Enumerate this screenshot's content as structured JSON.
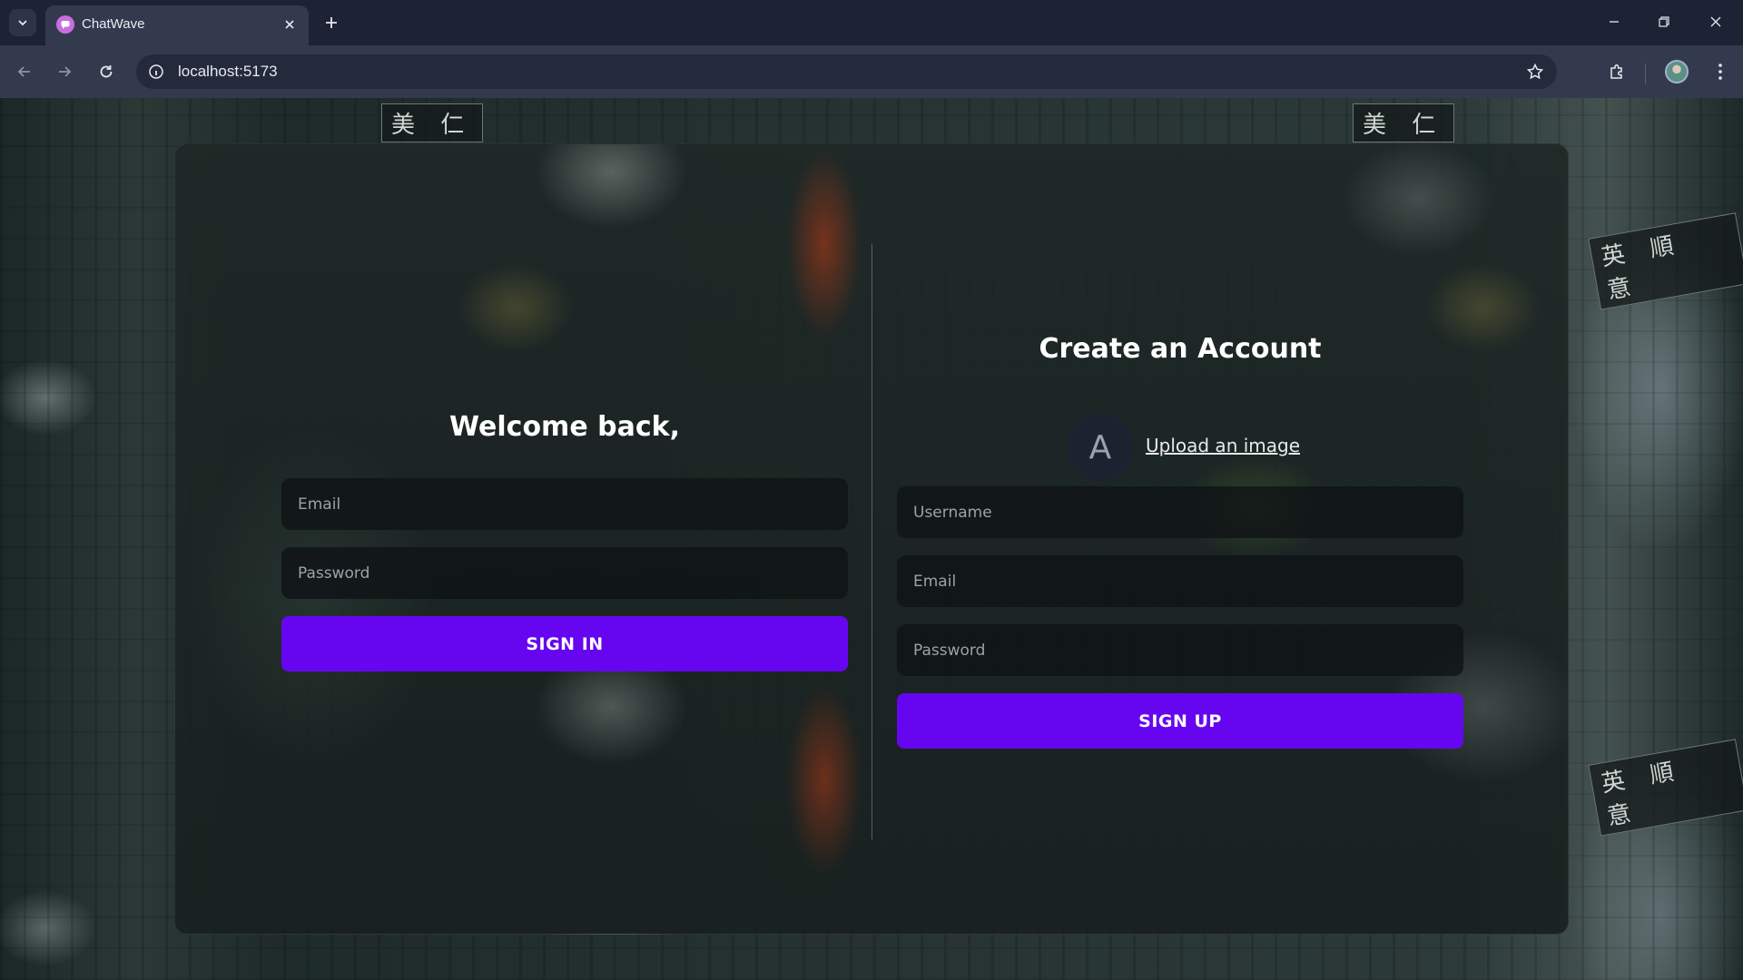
{
  "browser": {
    "tab_title": "ChatWave",
    "url": "localhost:5173",
    "icons": [
      "tab-list-icon",
      "chat-favicon",
      "close-icon",
      "plus-icon",
      "minimize-icon",
      "restore-icon",
      "close-window-icon",
      "back-arrow-icon",
      "forward-arrow-icon",
      "reload-icon",
      "info-icon",
      "star-icon",
      "extensions-icon",
      "profile-avatar",
      "more-vert-icon"
    ]
  },
  "background": {
    "signs": [
      "美 仁",
      "英 順 意"
    ]
  },
  "login": {
    "heading": "Welcome back,",
    "email_placeholder": "Email",
    "password_placeholder": "Password",
    "button_label": "SIGN IN"
  },
  "register": {
    "heading": "Create an Account",
    "avatar_letter": "A",
    "upload_label": "Upload an image",
    "username_placeholder": "Username",
    "email_placeholder": "Email",
    "password_placeholder": "Password",
    "button_label": "SIGN UP"
  },
  "colors": {
    "accent": "#6606f0",
    "tabbar": "#1e2235",
    "toolbar": "#343a4e"
  }
}
